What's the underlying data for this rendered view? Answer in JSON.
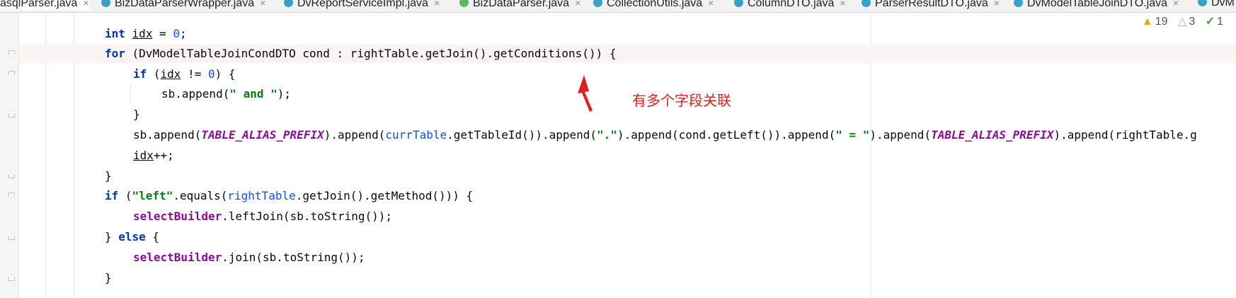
{
  "tabs": [
    {
      "label": "asqlParser.java",
      "icon": "class-icon",
      "active": true
    },
    {
      "label": "BizDataParserWrapper.java",
      "icon": "class-icon"
    },
    {
      "label": "DvReportServiceImpl.java",
      "icon": "class-icon"
    },
    {
      "label": "BizDataParser.java",
      "icon": "interface-icon"
    },
    {
      "label": "CollectionUtils.java",
      "icon": "class-icon"
    },
    {
      "label": "ColumnDTO.java",
      "icon": "class-icon"
    },
    {
      "label": "ParserResultDTO.java",
      "icon": "class-icon"
    },
    {
      "label": "DvModelTableJoinDTO.java",
      "icon": "class-icon"
    },
    {
      "label": "DvM",
      "icon": "class-icon"
    }
  ],
  "tab_close_glyph": "×",
  "inspections": {
    "warnings": "19",
    "weak_warnings": "3",
    "ok": "1",
    "warning_icon": "warning-triangle-icon",
    "weak_icon": "weak-warning-icon",
    "ok_icon": "checkmark-icon"
  },
  "code": {
    "l1": {
      "kw": "int",
      "var": "idx",
      "eq": " = ",
      "num": "0",
      "end": ";"
    },
    "l2": {
      "kw": "for",
      "t1": " (DvModelTableJoinCondDTO cond : rightTable.getJoin().getConditions()) {"
    },
    "l3": {
      "kw": "if",
      "t1": " (",
      "var": "idx",
      "t2": " != ",
      "num": "0",
      "t3": ") {"
    },
    "l4": {
      "t1": "sb.append(",
      "str": "\" and \"",
      "t2": ");"
    },
    "l5": {
      "t1": "}"
    },
    "l6": {
      "t1": "sb.append(",
      "c1": "TABLE_ALIAS_PREFIX",
      "t2": ").append(",
      "v1": "currTable",
      "t3": ".getTableId()).append(",
      "s1": "\".\"",
      "t4": ").append(cond.getLeft()).append(",
      "s2": "\" = \"",
      "t5": ").append(",
      "c2": "TABLE_ALIAS_PREFIX",
      "t6": ").append(rightTable.g"
    },
    "l7": {
      "var": "idx",
      "t1": "++;"
    },
    "l8": {
      "t1": "}"
    },
    "l9": {
      "kw": "if",
      "t1": " (",
      "str": "\"left\"",
      "t2": ".equals(",
      "v1": "rightTable",
      "t3": ".getJoin().getMethod())) {"
    },
    "l10": {
      "fld": "selectBuilder",
      "t1": ".leftJoin(sb.toString());"
    },
    "l11": {
      "t1": "} ",
      "kw": "else",
      "t2": " {"
    },
    "l12": {
      "fld": "selectBuilder",
      "t1": ".join(sb.toString());"
    },
    "l13": {
      "t1": "}"
    }
  },
  "annotation": {
    "text": "有多个字段关联",
    "color": "#e0201e"
  }
}
